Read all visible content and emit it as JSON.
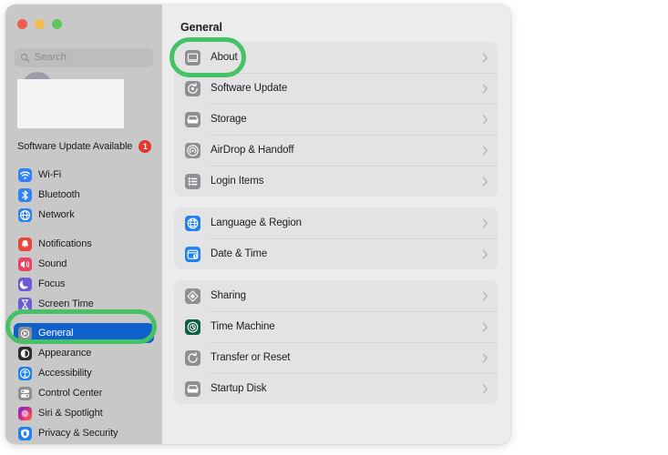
{
  "window": {
    "traffic_lights": [
      {
        "name": "close",
        "color": "#f05b51"
      },
      {
        "name": "minimize",
        "color": "#f2bd4c"
      },
      {
        "name": "zoom",
        "color": "#5fc75d"
      }
    ]
  },
  "sidebar": {
    "search": {
      "placeholder": "Search",
      "value": "",
      "icon": "search-icon"
    },
    "account": {
      "redacted": true,
      "avatar_icon": "avatar"
    },
    "software_update": {
      "label": "Software Update Available",
      "badge_count": "1",
      "badge_color": "#e0382f"
    },
    "groups": [
      {
        "items": [
          {
            "label": "Wi-Fi",
            "icon": "wifi-icon",
            "color": "#2f82f5",
            "selected": false
          },
          {
            "label": "Bluetooth",
            "icon": "bluetooth-icon",
            "color": "#2f82f5",
            "selected": false
          },
          {
            "label": "Network",
            "icon": "network-icon",
            "color": "#2f82f5",
            "selected": false
          }
        ]
      },
      {
        "items": [
          {
            "label": "Notifications",
            "icon": "notifications-icon",
            "color": "#e8483c",
            "selected": false
          },
          {
            "label": "Sound",
            "icon": "sound-icon",
            "color": "#ef4060",
            "selected": false
          },
          {
            "label": "Focus",
            "icon": "focus-icon",
            "color": "#6b5bd6",
            "selected": false
          },
          {
            "label": "Screen Time",
            "icon": "screen-time-icon",
            "color": "#6b5bd6",
            "selected": false
          }
        ]
      },
      {
        "items": [
          {
            "label": "General",
            "icon": "general-icon",
            "color": "#8e8e93",
            "selected": true
          },
          {
            "label": "Appearance",
            "icon": "appearance-icon",
            "color": "#2c2c2e",
            "selected": false
          },
          {
            "label": "Accessibility",
            "icon": "accessibility-icon",
            "color": "#1f82f0",
            "selected": false
          },
          {
            "label": "Control Center",
            "icon": "control-center-icon",
            "color": "#8e8e93",
            "selected": false
          },
          {
            "label": "Siri & Spotlight",
            "icon": "siri-icon",
            "color": "#cf3d78",
            "selected": false
          },
          {
            "label": "Privacy & Security",
            "icon": "privacy-icon",
            "color": "#1f82f0",
            "selected": false
          }
        ]
      }
    ]
  },
  "main": {
    "title": "General",
    "groups": [
      {
        "rows": [
          {
            "label": "About",
            "icon": "about-icon",
            "color": "#8e8e93",
            "chevron": "chevron-right-icon"
          },
          {
            "label": "Software Update",
            "icon": "software-update-icon",
            "color": "#8e8e93",
            "chevron": "chevron-right-icon"
          },
          {
            "label": "Storage",
            "icon": "storage-icon",
            "color": "#8e8e93",
            "chevron": "chevron-right-icon"
          },
          {
            "label": "AirDrop & Handoff",
            "icon": "airdrop-icon",
            "color": "#8e8e93",
            "chevron": "chevron-right-icon"
          },
          {
            "label": "Login Items",
            "icon": "login-items-icon",
            "color": "#8e8e93",
            "chevron": "chevron-right-icon"
          }
        ]
      },
      {
        "rows": [
          {
            "label": "Language & Region",
            "icon": "language-region-icon",
            "color": "#1f82f0",
            "chevron": "chevron-right-icon"
          },
          {
            "label": "Date & Time",
            "icon": "date-time-icon",
            "color": "#1f82f0",
            "chevron": "chevron-right-icon"
          }
        ]
      },
      {
        "rows": [
          {
            "label": "Sharing",
            "icon": "sharing-icon",
            "color": "#8e8e93",
            "chevron": "chevron-right-icon"
          },
          {
            "label": "Time Machine",
            "icon": "time-machine-icon",
            "color": "#10603f",
            "chevron": "chevron-right-icon"
          },
          {
            "label": "Transfer or Reset",
            "icon": "transfer-reset-icon",
            "color": "#8e8e93",
            "chevron": "chevron-right-icon"
          },
          {
            "label": "Startup Disk",
            "icon": "startup-disk-icon",
            "color": "#8e8e93",
            "chevron": "chevron-right-icon"
          }
        ]
      }
    ]
  },
  "annotations": {
    "color": "#44c265",
    "highlights": [
      {
        "name": "about-row",
        "target": "About"
      },
      {
        "name": "general-sidebar-item",
        "target": "General"
      }
    ]
  }
}
